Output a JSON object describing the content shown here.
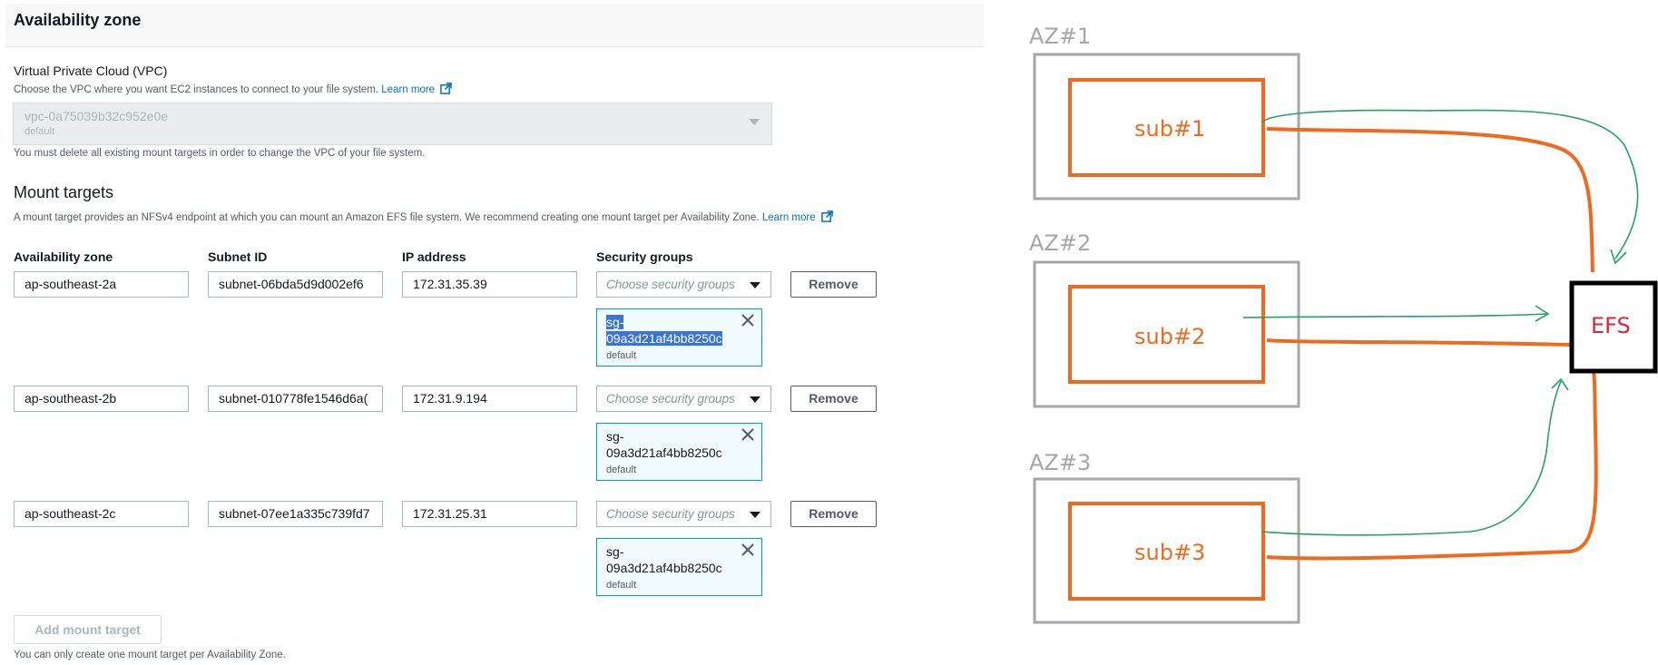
{
  "header": {
    "title": "Availability zone"
  },
  "vpc": {
    "label": "Virtual Private Cloud (VPC)",
    "description": "Choose the VPC where you want EC2 instances to connect to your file system.",
    "learn_more": "Learn more",
    "value": "vpc-0a75039b32c952e0e",
    "value_sub": "default",
    "note": "You must delete all existing mount targets in order to change the VPC of your file system."
  },
  "mount_targets": {
    "title": "Mount targets",
    "description": "A mount target provides an NFSv4 endpoint at which you can mount an Amazon EFS file system. We recommend creating one mount target per Availability Zone.",
    "learn_more": "Learn more",
    "columns": [
      "Availability zone",
      "Subnet ID",
      "IP address",
      "Security groups"
    ],
    "sg_placeholder": "Choose security groups",
    "remove_label": "Remove",
    "rows": [
      {
        "az": "ap-southeast-2a",
        "subnet": "subnet-06bda5d9d002ef6",
        "ip": "172.31.35.39",
        "sg_prefix": "sg-",
        "sg_id": "09a3d21af4bb8250c",
        "sg_sub": "default"
      },
      {
        "az": "ap-southeast-2b",
        "subnet": "subnet-010778fe1546d6a(",
        "ip": "172.31.9.194",
        "sg_prefix": "sg-",
        "sg_id": "09a3d21af4bb8250c",
        "sg_sub": "default"
      },
      {
        "az": "ap-southeast-2c",
        "subnet": "subnet-07ee1a335c739fd7",
        "ip": "172.31.25.31",
        "sg_prefix": "sg-",
        "sg_id": "09a3d21af4bb8250c",
        "sg_sub": "default"
      }
    ],
    "add_label": "Add mount target",
    "footnote": "You can only create one mount target per Availability Zone."
  },
  "diagram": {
    "az_labels": [
      "AZ#1",
      "AZ#2",
      "AZ#3"
    ],
    "subnet_labels": [
      "sub#1",
      "sub#2",
      "sub#3"
    ],
    "efs_label": "EFS",
    "colors": {
      "az_box": "#a6a6a6",
      "subnet": "#ee6a1f",
      "arrow": "#21a366",
      "efs_text": "#e0243a"
    }
  },
  "icons": {
    "external_link": "external-link-icon",
    "dropdown": "chevron-down-icon",
    "dismiss": "close-icon"
  },
  "accent": "#0073bb"
}
